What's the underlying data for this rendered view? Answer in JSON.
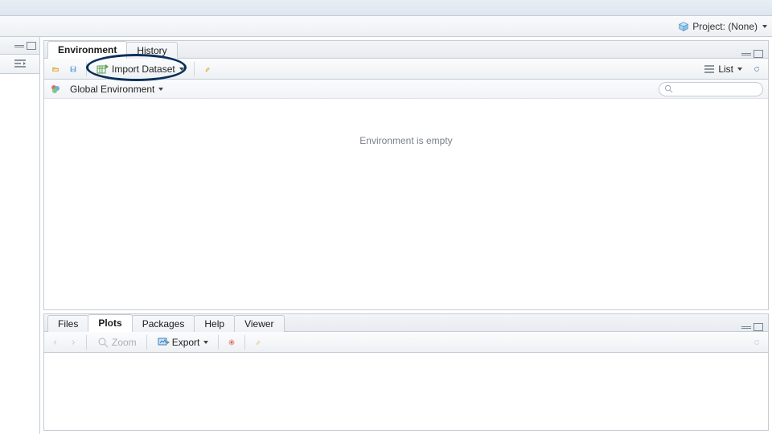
{
  "projectbar": {
    "label": "Project: (None)"
  },
  "env_panel": {
    "tabs": [
      {
        "label": "Environment"
      },
      {
        "label": "History"
      }
    ],
    "active_tab": 0,
    "toolbar": {
      "import_label": "Import Dataset",
      "list_label": "List"
    },
    "subbar": {
      "scope_label": "Global Environment",
      "search_placeholder": ""
    },
    "empty_message": "Environment is empty"
  },
  "plots_panel": {
    "tabs": [
      {
        "label": "Files"
      },
      {
        "label": "Plots"
      },
      {
        "label": "Packages"
      },
      {
        "label": "Help"
      },
      {
        "label": "Viewer"
      }
    ],
    "active_tab": 1,
    "toolbar": {
      "zoom_label": "Zoom",
      "export_label": "Export"
    }
  }
}
